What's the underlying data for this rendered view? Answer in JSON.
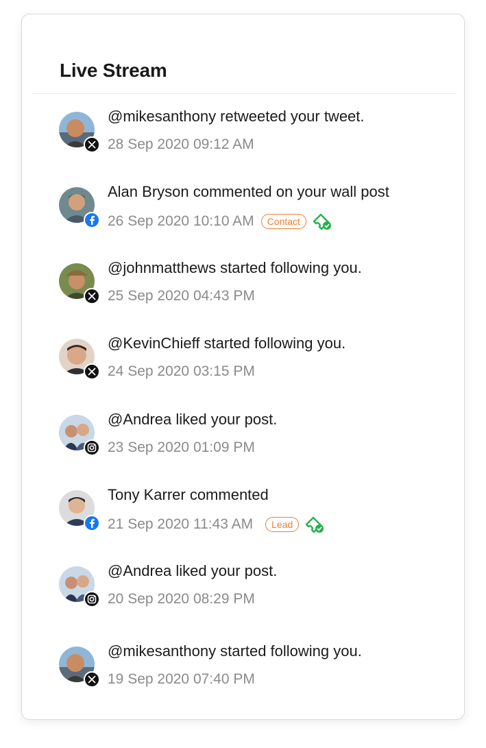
{
  "panel": {
    "title": "Live Stream"
  },
  "colors": {
    "tag": "#f07d2c",
    "verify": "#22b24c",
    "facebook": "#1877f2",
    "x": "#111111"
  },
  "items": [
    {
      "message": "@mikesanthony retweeted your tweet.",
      "time": "28 Sep 2020 09:12 AM",
      "network": "x-icon"
    },
    {
      "message": "Alan Bryson commented on your wall post",
      "time": "26 Sep 2020 10:10 AM",
      "network": "facebook-icon",
      "tag": "Contact"
    },
    {
      "message": "@johnmatthews started following you.",
      "time": "25 Sep 2020 04:43 PM",
      "network": "x-icon"
    },
    {
      "message": "@KevinChieff started following you.",
      "time": "24 Sep 2020 03:15 PM",
      "network": "x-icon"
    },
    {
      "message": "@Andrea liked your post.",
      "time": "23 Sep 2020 01:09 PM",
      "network": "instagram-icon"
    },
    {
      "message": "Tony Karrer commented",
      "time": "21 Sep 2020 11:43 AM",
      "network": "facebook-icon",
      "tag": "Lead"
    },
    {
      "message": "@Andrea liked your post.",
      "time": "20 Sep 2020 08:29 PM",
      "network": "instagram-icon"
    },
    {
      "message": "@mikesanthony started following you.",
      "time": "19 Sep 2020 07:40 PM",
      "network": "x-icon"
    }
  ]
}
